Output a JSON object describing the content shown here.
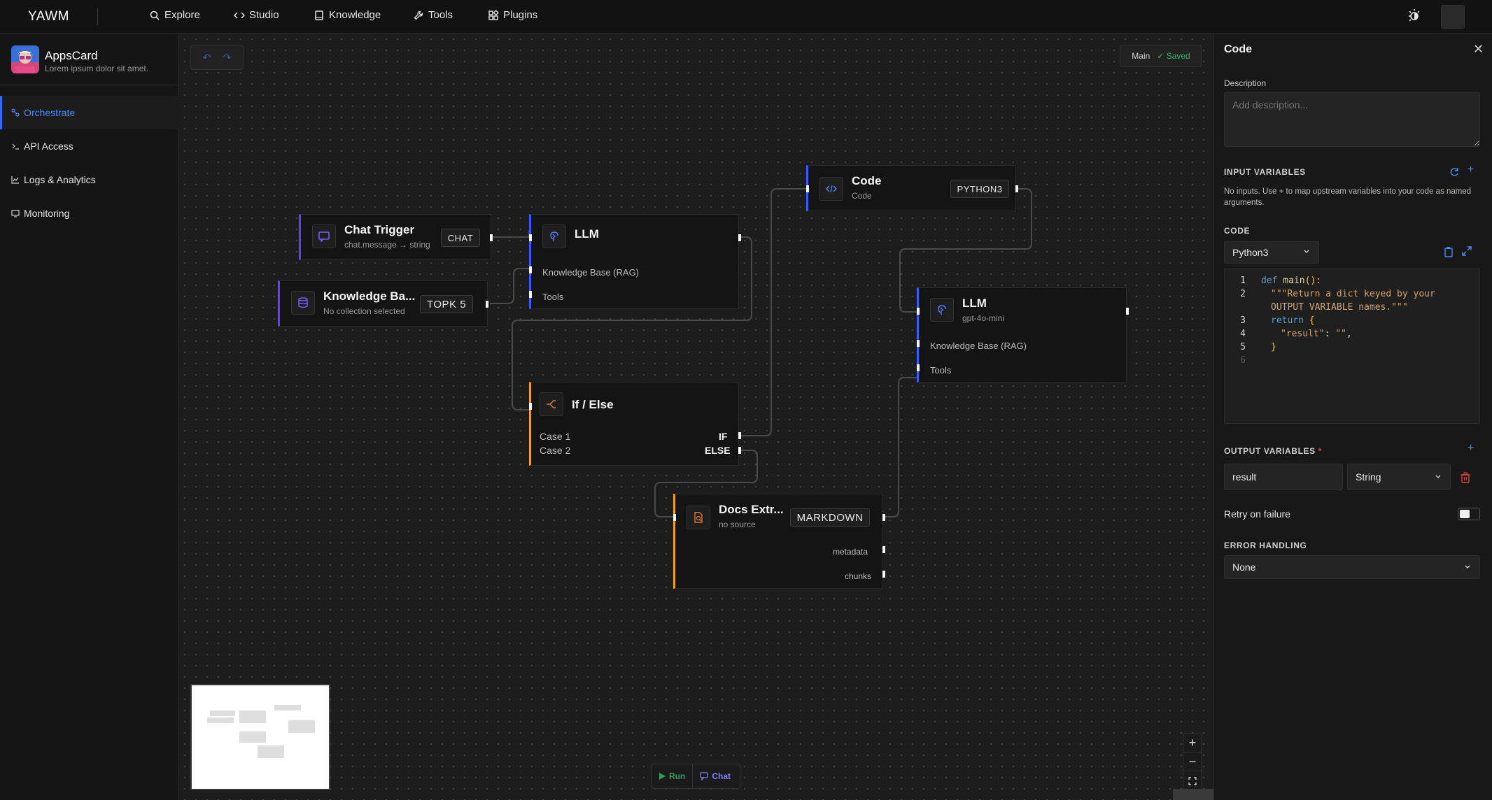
{
  "topbar": {
    "brand": "YAWM",
    "nav": [
      {
        "label": "Explore",
        "icon": "search-icon"
      },
      {
        "label": "Studio",
        "icon": "code-icon"
      },
      {
        "label": "Knowledge",
        "icon": "book-icon"
      },
      {
        "label": "Tools",
        "icon": "wrench-icon"
      },
      {
        "label": "Plugins",
        "icon": "plugin-icon"
      }
    ]
  },
  "sidebar": {
    "app_name": "AppsCard",
    "app_desc": "Lorem ipsum dolor sit amet.",
    "items": [
      {
        "label": "Orchestrate",
        "active": true
      },
      {
        "label": "API Access",
        "active": false
      },
      {
        "label": "Logs & Analytics",
        "active": false
      },
      {
        "label": "Monitoring",
        "active": false
      }
    ]
  },
  "canvas": {
    "branch": "Main",
    "status": "Saved",
    "nodes": {
      "chat_trigger": {
        "title": "Chat Trigger",
        "sub": "chat.message → string",
        "badge": "CHAT"
      },
      "knowledge": {
        "title": "Knowledge Ba...",
        "sub": "No collection selected",
        "badge": "TOPK 5"
      },
      "llm1": {
        "title": "LLM",
        "row1": "Knowledge Base (RAG)",
        "row2": "Tools"
      },
      "code": {
        "title": "Code",
        "sub": "Code",
        "badge": "PYTHON3"
      },
      "llm2": {
        "title": "LLM",
        "sub": "gpt-4o-mini",
        "row1": "Knowledge Base (RAG)",
        "row2": "Tools"
      },
      "ifelse": {
        "title": "If / Else",
        "case1": "Case 1",
        "case2": "Case 2",
        "if_label": "IF",
        "else_label": "ELSE"
      },
      "docs": {
        "title": "Docs Extr...",
        "sub": "no source",
        "badge": "MARKDOWN",
        "out1": "metadata",
        "out2": "chunks"
      }
    },
    "run_label": "Run",
    "chat_label": "Chat"
  },
  "panel": {
    "title": "Code",
    "description_label": "Description",
    "description_placeholder": "Add description...",
    "input_variables_label": "INPUT VARIABLES",
    "input_hint": "No inputs. Use + to map upstream variables into your code as named arguments.",
    "code_label": "CODE",
    "language": "Python3",
    "code_lines": [
      "1",
      "2",
      "3",
      "4",
      "5",
      "6"
    ],
    "code": {
      "l1a": "def",
      "l1b": " main",
      "l1c": "():",
      "l2": "\"\"\"Return a dict keyed by your",
      "l2b": "OUTPUT VARIABLE names.\"\"\"",
      "l3a": "return",
      "l3b": " {",
      "l4a": "\"result\"",
      "l4b": ": ",
      "l4c": "\"\"",
      "l4d": ",",
      "l5": "}"
    },
    "output_variables_label": "OUTPUT VARIABLES",
    "required_mark": "*",
    "output_name": "result",
    "output_type": "String",
    "retry_label": "Retry on failure",
    "error_handling_label": "ERROR HANDLING",
    "error_handling_value": "None"
  },
  "colors": {
    "accent": "#3b5bff",
    "trigger": "#6b3cff",
    "logic": "#f0a020",
    "saved": "#2fb66b"
  }
}
